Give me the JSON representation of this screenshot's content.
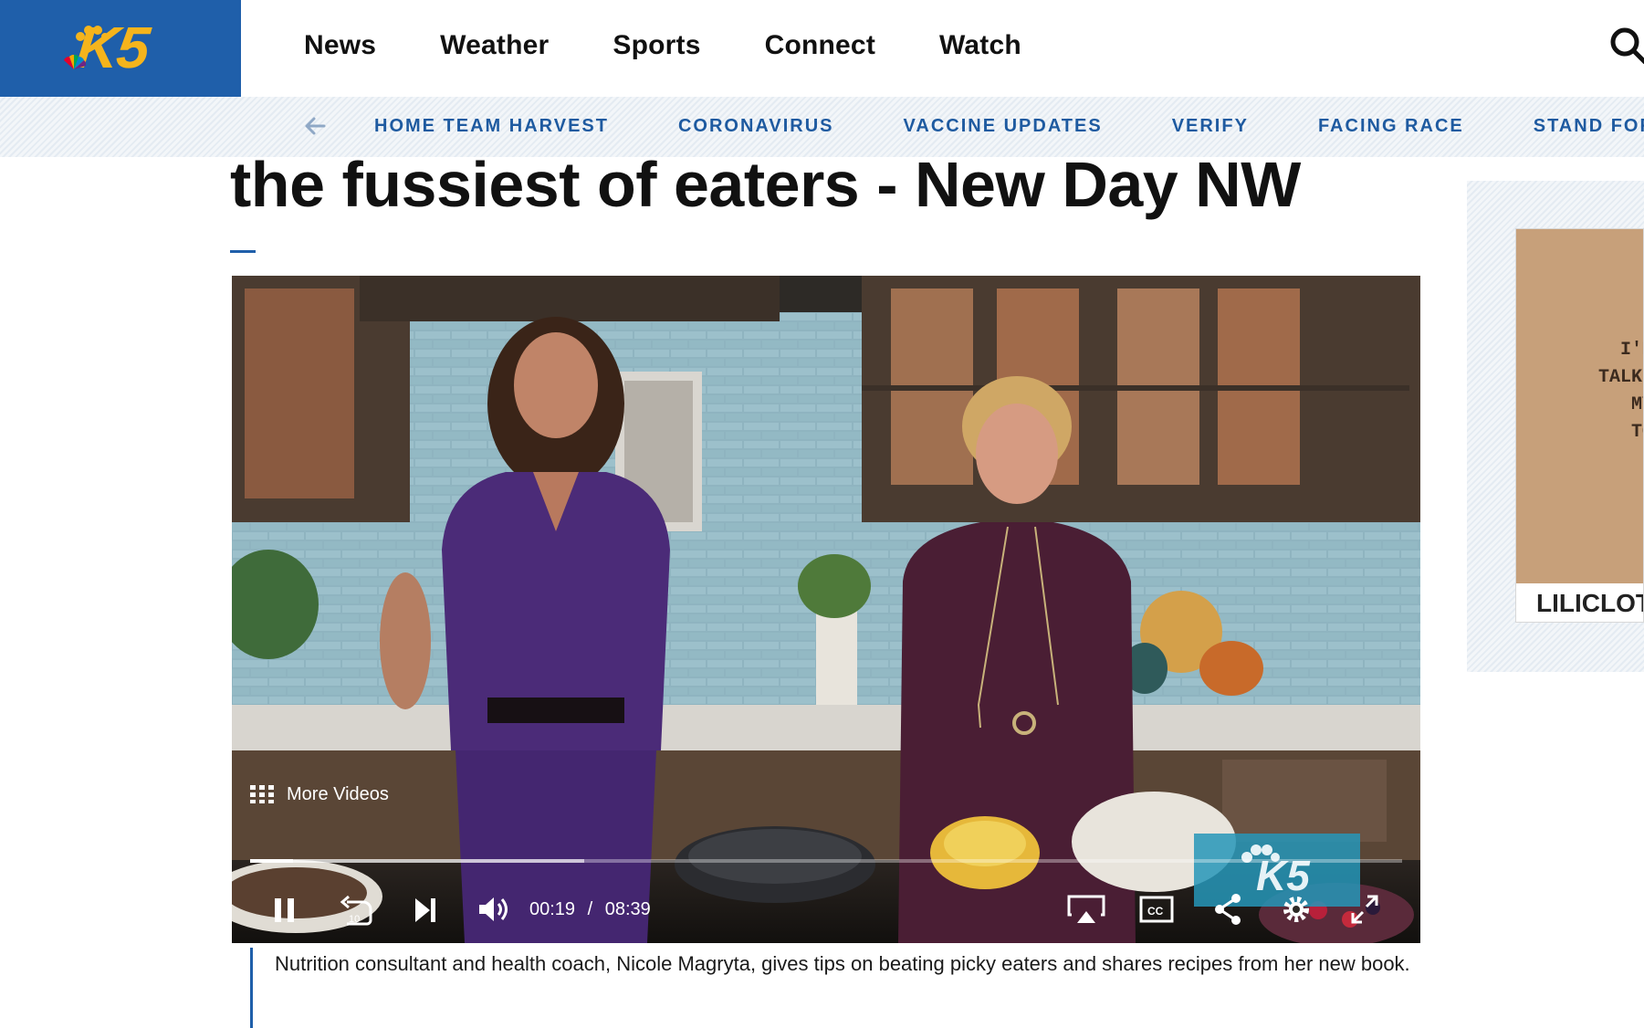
{
  "header": {
    "logo_text": "K5",
    "nav": [
      "News",
      "Weather",
      "Sports",
      "Connect",
      "Watch"
    ]
  },
  "subnav": {
    "items": [
      "HOME TEAM HARVEST",
      "CORONAVIRUS",
      "VACCINE UPDATES",
      "VERIFY",
      "FACING RACE",
      "STAND FOR"
    ]
  },
  "article": {
    "headline": "the fussiest of eaters - New Day NW",
    "caption": "Nutrition consultant and health coach, Nicole Magryta, gives tips on beating picky eaters and shares recipes from her new book."
  },
  "player": {
    "more_videos_label": "More Videos",
    "current_time": "00:19",
    "separator": "/",
    "duration": "08:39",
    "progress_fraction": 0.037,
    "buffered_fraction": 0.29,
    "state": "playing"
  },
  "ad": {
    "shirt_text": "I'M\nTALKI\nMY\nTO",
    "brand": "LILICLOT"
  },
  "colors": {
    "brand_blue": "#1f5faa",
    "logo_yellow": "#f5b41c",
    "link_blue": "#1e5aa0"
  },
  "icons": {
    "search": "search-icon",
    "back": "arrow-left-icon",
    "pause": "pause-icon",
    "replay": "replay-10-icon",
    "next": "skip-next-icon",
    "volume": "volume-icon",
    "airplay": "airplay-icon",
    "cc": "closed-captions-icon",
    "share": "share-icon",
    "settings": "gear-icon",
    "fullscreen": "fullscreen-icon",
    "more_videos": "grid-icon"
  }
}
